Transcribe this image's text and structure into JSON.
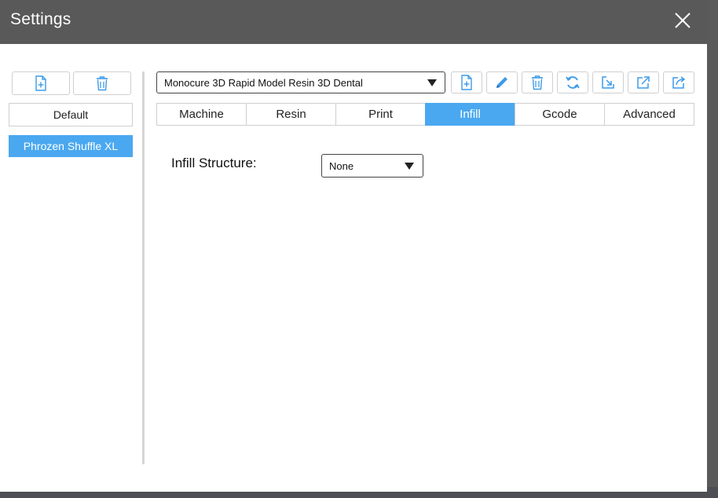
{
  "window": {
    "title": "Settings"
  },
  "icons": {
    "close": "close-icon",
    "new": "new-file-icon",
    "delete": "trash-icon",
    "edit": "pencil-icon",
    "refresh": "refresh-icon",
    "import": "import-icon",
    "export": "export-icon",
    "export_alt": "share-icon",
    "dropdown": "chevron-down-icon"
  },
  "profiles": {
    "items": [
      "Default",
      "Phrozen Shuffle XL"
    ],
    "selected": "Phrozen Shuffle XL"
  },
  "resin_selector": {
    "value": "Monocure 3D Rapid Model Resin 3D Dental"
  },
  "tabs": [
    {
      "label": "Machine",
      "active": false
    },
    {
      "label": "Resin",
      "active": false
    },
    {
      "label": "Print",
      "active": false
    },
    {
      "label": "Infill",
      "active": true
    },
    {
      "label": "Gcode",
      "active": false
    },
    {
      "label": "Advanced",
      "active": false
    }
  ],
  "infill": {
    "structure_label": "Infill Structure:",
    "structure_value": "None"
  },
  "colors": {
    "accent": "#4aa8f0",
    "titlebar": "#595959",
    "border": "#cfcfcf"
  }
}
